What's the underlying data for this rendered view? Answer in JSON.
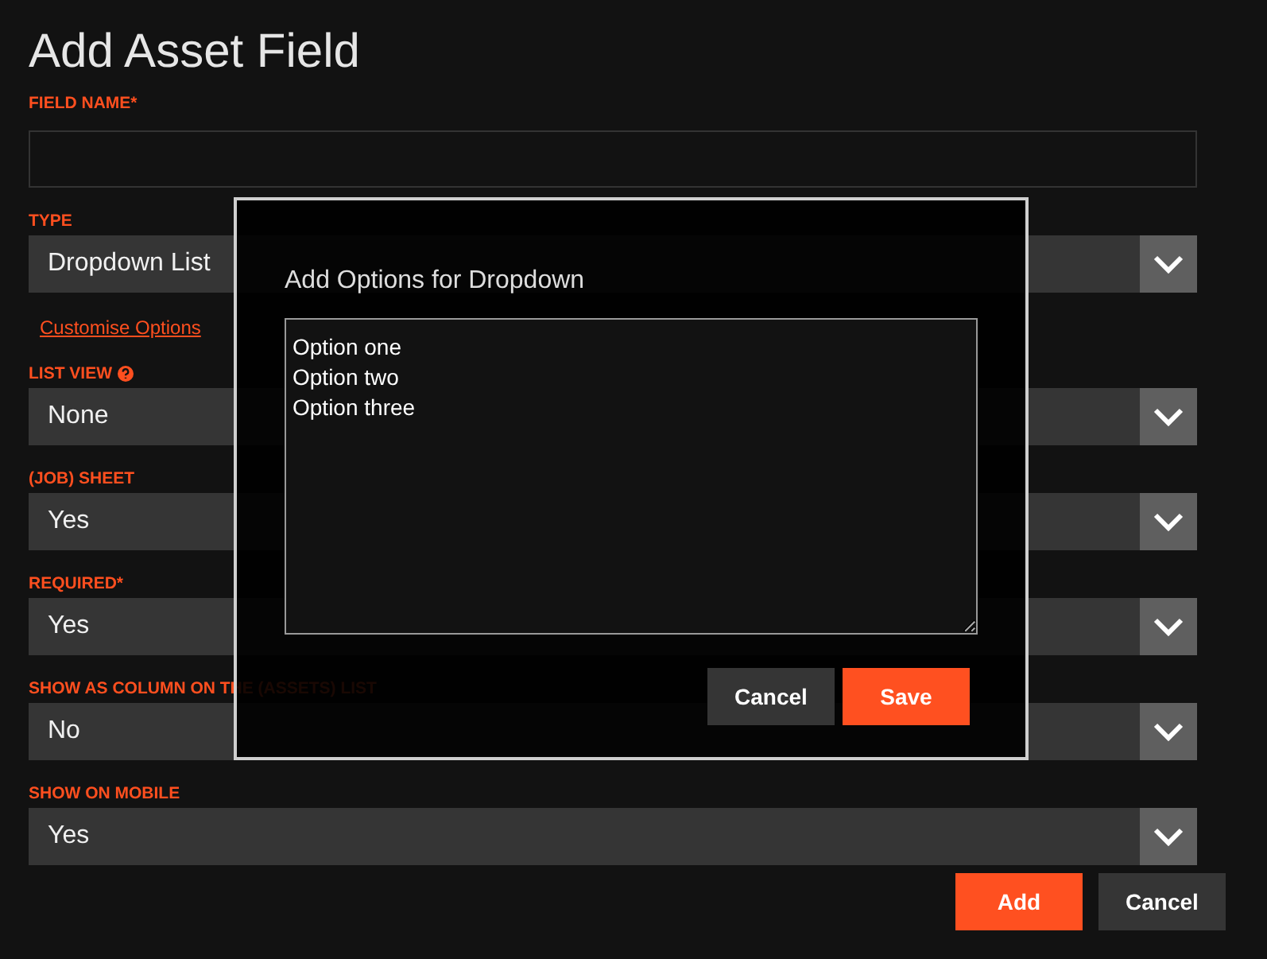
{
  "title": "Add Asset Field",
  "fields": [
    {
      "kind": "text",
      "label": "FIELD NAME*"
    },
    {
      "kind": "select",
      "label": "TYPE",
      "value": "Dropdown List"
    },
    {
      "kind": "link",
      "label": "Customise Options"
    },
    {
      "kind": "select",
      "label": "LIST VIEW",
      "help": true,
      "value": "None"
    },
    {
      "kind": "select",
      "label": "(JOB) SHEET",
      "value": "Yes"
    },
    {
      "kind": "select",
      "label": "REQUIRED*",
      "value": "Yes"
    },
    {
      "kind": "select",
      "label": "SHOW AS COLUMN ON THE (ASSETS) LIST",
      "value": "No"
    },
    {
      "kind": "select",
      "label": "SHOW ON MOBILE",
      "value": "Yes"
    }
  ],
  "buttons": [
    {
      "label": "Add",
      "primary": true
    },
    {
      "label": "Cancel",
      "primary": false
    }
  ],
  "modal": {
    "title": "Add Options for Dropdown",
    "text": "Option one\nOption two\nOption three",
    "buttons": [
      {
        "label": "Cancel",
        "primary": false
      },
      {
        "label": "Save",
        "primary": true
      }
    ]
  }
}
